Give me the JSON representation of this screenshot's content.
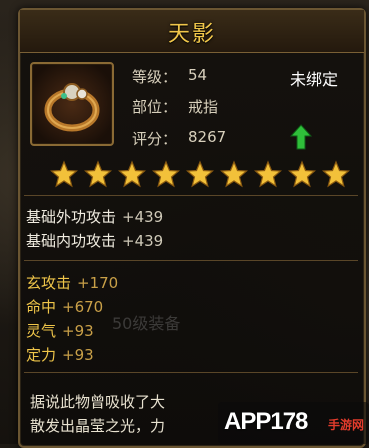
{
  "item": {
    "name": "天影",
    "bind_status": "未绑定",
    "stats": [
      {
        "label": "等级：",
        "value": "54"
      },
      {
        "label": "部位：",
        "value": "戒指"
      },
      {
        "label": "评分：",
        "value": "8267"
      }
    ],
    "stars": 9
  },
  "base_attributes": [
    {
      "label": "基础外功攻击",
      "value": "+439"
    },
    {
      "label": "基础内功攻击",
      "value": "+439"
    }
  ],
  "extra_attributes": [
    {
      "label": "玄攻击",
      "value": "+170"
    },
    {
      "label": "命中",
      "value": "+670"
    },
    {
      "label": "灵气",
      "value": "+93"
    },
    {
      "label": "定力",
      "value": "+93"
    }
  ],
  "background_text": "50级装备",
  "description": [
    "据说此物曾吸收了大",
    "散发出晶莹之光，力"
  ],
  "watermark": {
    "brand": "APP178",
    "sub": "手游网"
  },
  "colors": {
    "title": "#f0c64a",
    "accent": "#c9a048",
    "up_arrow": "#2fbf3a"
  }
}
